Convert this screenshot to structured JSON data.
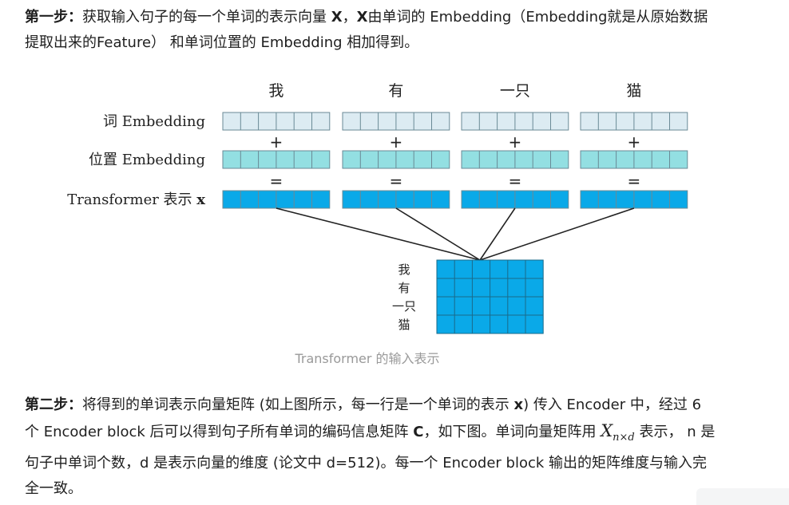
{
  "p1": {
    "lead": "第一步：",
    "text_a": "获取输入句子的每一个单词的表示向量 ",
    "x1": "X",
    "sep": "，",
    "x2": "X",
    "text_b": "由单词的 Embedding（Embedding就是从原始数据提取出来的Feature） 和单词位置的 Embedding 相加得到。"
  },
  "figure": {
    "words": [
      "我",
      "有",
      "一只",
      "猫"
    ],
    "rows": [
      {
        "label": "词 Embedding",
        "color": "#dcebf2"
      },
      {
        "label": "位置 Embedding",
        "color": "#93dfe2"
      },
      {
        "label": "Transformer 表示",
        "label_var": "x",
        "color": "#0aa9e8"
      }
    ],
    "plus": "+",
    "equals": "=",
    "matrix_words": [
      "我",
      "有",
      "一只",
      "猫"
    ],
    "matrix_color": "#0aa9e8",
    "caption": "Transformer 的输入表示"
  },
  "p2": {
    "lead": "第二步：",
    "text_a": "将得到的单词表示向量矩阵 (如上图所示，每一行是一个单词的表示 ",
    "x": "x",
    "text_b": ") 传入 Encoder 中，经过 6 个 Encoder block 后可以得到句子所有单词的编码信息矩阵 ",
    "c": "C",
    "text_c": "，如下图。单词向量矩阵用 ",
    "math": "X",
    "math_sub": "n×d",
    "text_d": " 表示， n 是句子中单词个数，d 是表示向量的维度 (论文中 d=512)。每一个 Encoder block 输出的矩阵维度与输入完全一致。"
  }
}
